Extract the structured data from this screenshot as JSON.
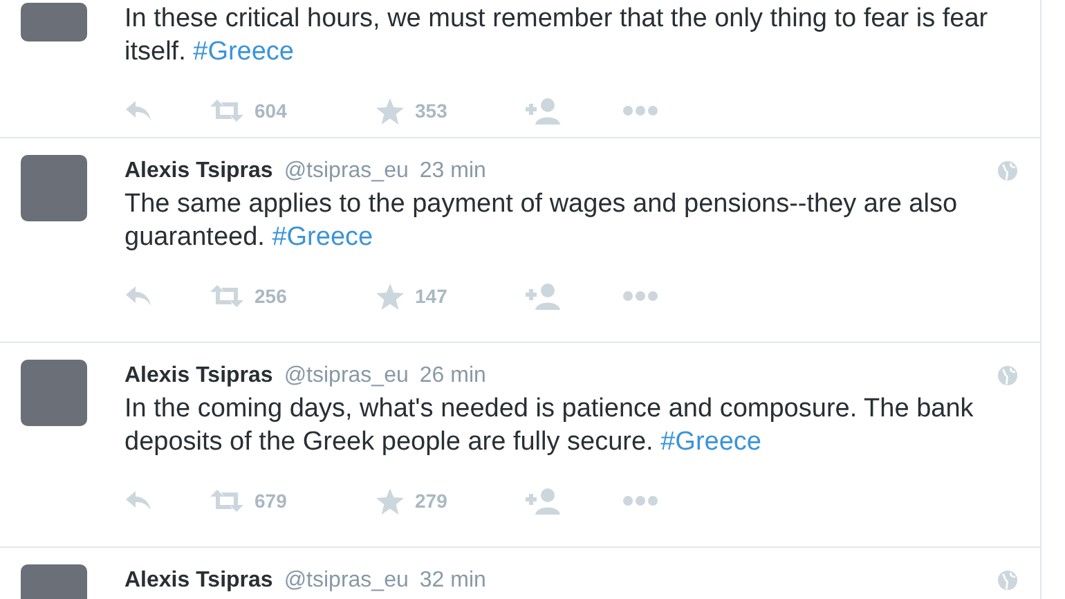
{
  "tweets": [
    {
      "text": "In these critical hours, we must remember that the only thing to fear is fear itself.",
      "hashtag": "#Greece",
      "retweets": "604",
      "favorites": "353"
    },
    {
      "author": "Alexis Tsipras",
      "handle": "@tsipras_eu",
      "time": "23 min",
      "text": "The same applies to the payment of wages and pensions--they are also guaranteed.",
      "hashtag": "#Greece",
      "retweets": "256",
      "favorites": "147"
    },
    {
      "author": "Alexis Tsipras",
      "handle": "@tsipras_eu",
      "time": "26 min",
      "text": "In the coming days, what's needed is patience and composure. The bank deposits of the Greek people are fully secure.",
      "hashtag": "#Greece",
      "retweets": "679",
      "favorites": "279"
    },
    {
      "author": "Alexis Tsipras",
      "handle": "@tsipras_eu",
      "time": "32 min"
    }
  ]
}
